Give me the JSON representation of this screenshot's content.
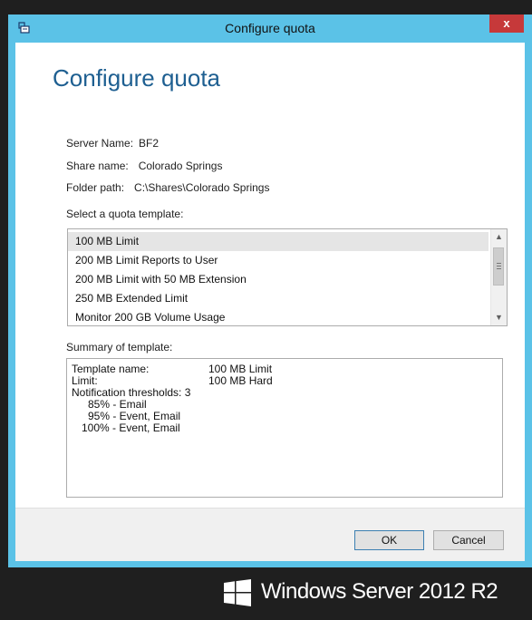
{
  "window": {
    "title": "Configure quota",
    "close_label": "x"
  },
  "dialog": {
    "heading": "Configure quota",
    "server": {
      "label": "Server Name:",
      "value": "BF2"
    },
    "share": {
      "label": "Share name:",
      "value": "Colorado Springs"
    },
    "folder": {
      "label": "Folder path:",
      "value": "C:\\Shares\\Colorado Springs"
    },
    "template_prompt": "Select a quota template:",
    "templates": [
      "100 MB Limit",
      "200 MB Limit Reports to User",
      "200 MB Limit with 50 MB Extension",
      "250 MB Extended Limit",
      "Monitor 200 GB Volume Usage"
    ],
    "selected_template": "100 MB Limit",
    "summary_label": "Summary of template:",
    "summary": {
      "template_name_label": "Template name:",
      "template_name_value": "100 MB Limit",
      "limit_label": "Limit:",
      "limit_value": "100 MB Hard",
      "thresholds_label": "Notification thresholds:",
      "thresholds_value": "3",
      "threshold_lines": [
        "85% - Email",
        "95% - Event, Email",
        "100% - Event, Email"
      ]
    },
    "ok_label": "OK",
    "cancel_label": "Cancel"
  },
  "branding": {
    "text": "Windows Server 2012 R2",
    "logo_color": "#ffffff"
  },
  "colors": {
    "titlebar": "#5bc2e7",
    "heading": "#1e5f91",
    "close": "#c6393a",
    "background": "#1f1f1f"
  }
}
